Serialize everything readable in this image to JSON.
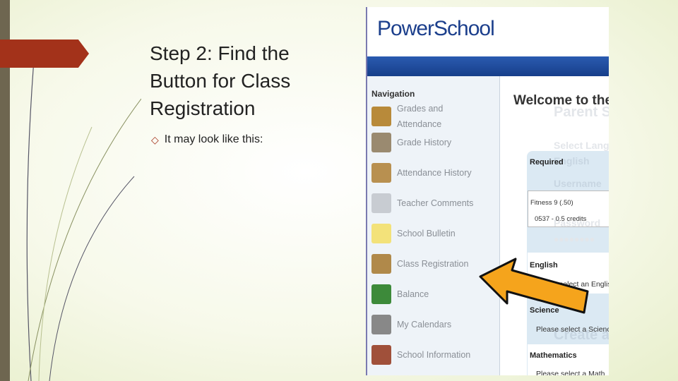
{
  "slide": {
    "title": "Step 2: Find the Button for Class Registration",
    "bullet": "It may look like this:",
    "bullet_icon": "diamond-outline-icon",
    "accent": "#a3321a"
  },
  "screenshot": {
    "logo": "PowerSchool",
    "nav_heading": "Navigation",
    "nav_items": [
      {
        "label": "Grades and Attendance",
        "icon": "gradebook-icon"
      },
      {
        "label": "Grade History",
        "icon": "grade-history-icon"
      },
      {
        "label": "Attendance History",
        "icon": "attendance-clock-icon"
      },
      {
        "label": "Teacher Comments",
        "icon": "speech-bubble-icon"
      },
      {
        "label": "School Bulletin",
        "icon": "sticky-note-icon"
      },
      {
        "label": "Class Registration",
        "icon": "desk-pencil-icon"
      },
      {
        "label": "Balance",
        "icon": "money-icon"
      },
      {
        "label": "My Calendars",
        "icon": "calendar-icon"
      },
      {
        "label": "School Information",
        "icon": "school-building-icon"
      }
    ],
    "welcome": "Welcome to the",
    "ghost": [
      "Parent S",
      "Select Lang",
      "English",
      "Username",
      "Password",
      "●●●●●●●●",
      "Create a"
    ],
    "required": "Required",
    "course": "Fitness 9 (.50)",
    "course_credits": "0537 - 0.5 credits",
    "sections": [
      {
        "title": "English",
        "prompt": "Please select an English"
      },
      {
        "title": "Science",
        "prompt": "Please select a Science"
      },
      {
        "title": "Mathematics",
        "prompt": "Please select a Math"
      }
    ],
    "arrow_color": "#f5a41c"
  }
}
